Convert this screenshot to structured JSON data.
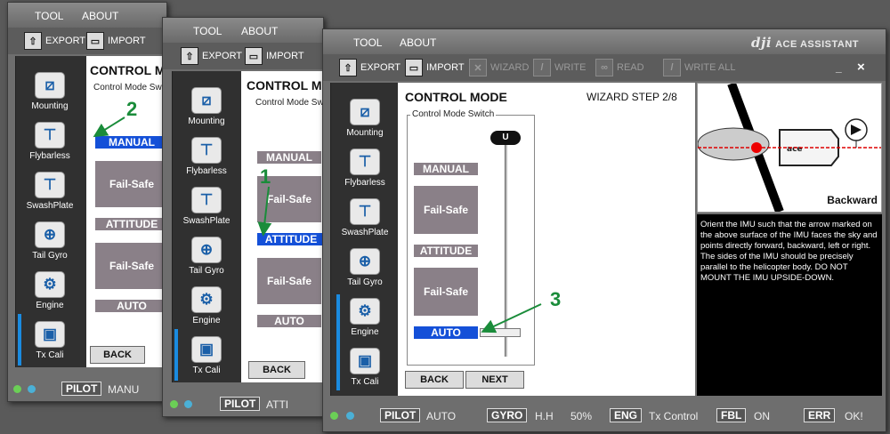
{
  "menu": {
    "tool": "TOOL",
    "about": "ABOUT"
  },
  "brand": {
    "logo": "dji",
    "name": "ACE ASSISTANT"
  },
  "toolbar": {
    "export": "EXPORT",
    "import": "IMPORT",
    "wizard": "WIZARD",
    "write": "WRITE",
    "read": "READ",
    "write_all": "WRITE ALL"
  },
  "sidebar": {
    "mounting": "Mounting",
    "flybarless": "Flybarless",
    "swashplate": "SwashPlate",
    "tail_gyro": "Tail Gyro",
    "engine": "Engine",
    "tx_cali": "Tx Cali"
  },
  "page": {
    "title": "CONTROL MODE",
    "step": "WIZARD STEP 2/8",
    "group": "Control Mode Switch"
  },
  "modes": {
    "manual": "MANUAL",
    "failsafe": "Fail-Safe",
    "attitude": "ATTITUDE",
    "auto": "AUTO",
    "slider_top": "U"
  },
  "buttons": {
    "back": "BACK",
    "next": "NEXT"
  },
  "imu": {
    "caption": "Backward",
    "instructions": "Orient the IMU such that the arrow marked on the above surface of the IMU faces the sky and points directly forward, backward, left or right. The sides of the IMU should be precisely parallel to the helicopter body. DO NOT MOUNT THE IMU UPSIDE-DOWN."
  },
  "status": {
    "pilot": "PILOT",
    "pilot_w1": "MANU",
    "pilot_w2": "ATTI",
    "pilot_w3": "AUTO",
    "gyro": "GYRO",
    "gyro_val": "H.H",
    "gyro_pct": "50%",
    "eng": "ENG",
    "eng_val": "Tx Control",
    "fbl": "FBL",
    "fbl_val": "ON",
    "err": "ERR",
    "err_val": "OK!"
  },
  "window": {
    "minimize": "_",
    "close": "×"
  },
  "callouts": {
    "c1": "1",
    "c2": "2",
    "c3": "3"
  },
  "colors": {
    "active": "#1450d8",
    "inactive": "#8a8088",
    "arrow": "#1a8c3a",
    "nav_sel": "#1a8be0"
  }
}
